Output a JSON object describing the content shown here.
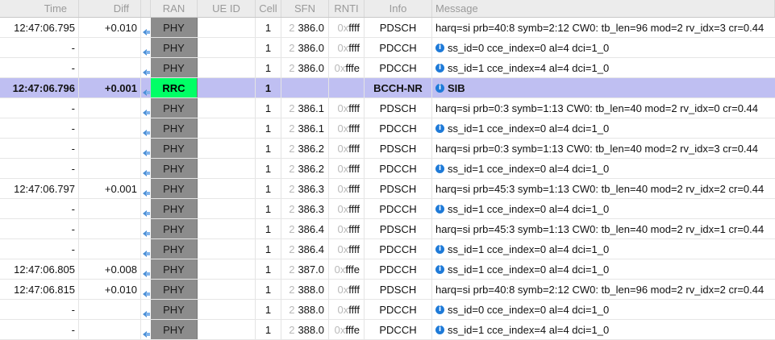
{
  "columns": {
    "time": "Time",
    "diff": "Diff",
    "ran": "RAN",
    "ue_id": "UE ID",
    "cell": "Cell",
    "sfn": "SFN",
    "rnti": "RNTI",
    "info": "Info",
    "message": "Message"
  },
  "colors": {
    "phy": "#8c8c8c",
    "rrc": "#00ff66",
    "selected_row": "#bfbff2"
  },
  "rows": [
    {
      "time": "12:47:06.795",
      "diff": "+0.010",
      "ran": "PHY",
      "ue_id": "",
      "cell": "1",
      "sfn_prefix": "2",
      "sfn": "386.0",
      "rnti_prefix": "0x",
      "rnti": "ffff",
      "info": "PDSCH",
      "info_icon": false,
      "message": "harq=si prb=40:8 symb=2:12 CW0: tb_len=96 mod=2 rv_idx=3 cr=0.44"
    },
    {
      "time": "-",
      "diff": "",
      "ran": "PHY",
      "ue_id": "",
      "cell": "1",
      "sfn_prefix": "2",
      "sfn": "386.0",
      "rnti_prefix": "0x",
      "rnti": "ffff",
      "info": "PDCCH",
      "info_icon": true,
      "message": "ss_id=0 cce_index=0 al=4 dci=1_0"
    },
    {
      "time": "-",
      "diff": "",
      "ran": "PHY",
      "ue_id": "",
      "cell": "1",
      "sfn_prefix": "2",
      "sfn": "386.0",
      "rnti_prefix": "0x",
      "rnti": "fffe",
      "info": "PDCCH",
      "info_icon": true,
      "message": "ss_id=1 cce_index=4 al=4 dci=1_0"
    },
    {
      "time": "12:47:06.796",
      "diff": "+0.001",
      "ran": "RRC",
      "ue_id": "",
      "cell": "1",
      "sfn_prefix": "",
      "sfn": "",
      "rnti_prefix": "",
      "rnti": "",
      "info": "BCCH-NR",
      "info_icon": true,
      "message": "SIB",
      "selected": true
    },
    {
      "time": "-",
      "diff": "",
      "ran": "PHY",
      "ue_id": "",
      "cell": "1",
      "sfn_prefix": "2",
      "sfn": "386.1",
      "rnti_prefix": "0x",
      "rnti": "ffff",
      "info": "PDSCH",
      "info_icon": false,
      "message": "harq=si prb=0:3 symb=1:13 CW0: tb_len=40 mod=2 rv_idx=0 cr=0.44"
    },
    {
      "time": "-",
      "diff": "",
      "ran": "PHY",
      "ue_id": "",
      "cell": "1",
      "sfn_prefix": "2",
      "sfn": "386.1",
      "rnti_prefix": "0x",
      "rnti": "ffff",
      "info": "PDCCH",
      "info_icon": true,
      "message": "ss_id=1 cce_index=0 al=4 dci=1_0"
    },
    {
      "time": "-",
      "diff": "",
      "ran": "PHY",
      "ue_id": "",
      "cell": "1",
      "sfn_prefix": "2",
      "sfn": "386.2",
      "rnti_prefix": "0x",
      "rnti": "ffff",
      "info": "PDSCH",
      "info_icon": false,
      "message": "harq=si prb=0:3 symb=1:13 CW0: tb_len=40 mod=2 rv_idx=3 cr=0.44"
    },
    {
      "time": "-",
      "diff": "",
      "ran": "PHY",
      "ue_id": "",
      "cell": "1",
      "sfn_prefix": "2",
      "sfn": "386.2",
      "rnti_prefix": "0x",
      "rnti": "ffff",
      "info": "PDCCH",
      "info_icon": true,
      "message": "ss_id=1 cce_index=0 al=4 dci=1_0"
    },
    {
      "time": "12:47:06.797",
      "diff": "+0.001",
      "ran": "PHY",
      "ue_id": "",
      "cell": "1",
      "sfn_prefix": "2",
      "sfn": "386.3",
      "rnti_prefix": "0x",
      "rnti": "ffff",
      "info": "PDSCH",
      "info_icon": false,
      "message": "harq=si prb=45:3 symb=1:13 CW0: tb_len=40 mod=2 rv_idx=2 cr=0.44"
    },
    {
      "time": "-",
      "diff": "",
      "ran": "PHY",
      "ue_id": "",
      "cell": "1",
      "sfn_prefix": "2",
      "sfn": "386.3",
      "rnti_prefix": "0x",
      "rnti": "ffff",
      "info": "PDCCH",
      "info_icon": true,
      "message": "ss_id=1 cce_index=0 al=4 dci=1_0"
    },
    {
      "time": "-",
      "diff": "",
      "ran": "PHY",
      "ue_id": "",
      "cell": "1",
      "sfn_prefix": "2",
      "sfn": "386.4",
      "rnti_prefix": "0x",
      "rnti": "ffff",
      "info": "PDSCH",
      "info_icon": false,
      "message": "harq=si prb=45:3 symb=1:13 CW0: tb_len=40 mod=2 rv_idx=1 cr=0.44"
    },
    {
      "time": "-",
      "diff": "",
      "ran": "PHY",
      "ue_id": "",
      "cell": "1",
      "sfn_prefix": "2",
      "sfn": "386.4",
      "rnti_prefix": "0x",
      "rnti": "ffff",
      "info": "PDCCH",
      "info_icon": true,
      "message": "ss_id=1 cce_index=0 al=4 dci=1_0"
    },
    {
      "time": "12:47:06.805",
      "diff": "+0.008",
      "ran": "PHY",
      "ue_id": "",
      "cell": "1",
      "sfn_prefix": "2",
      "sfn": "387.0",
      "rnti_prefix": "0x",
      "rnti": "fffe",
      "info": "PDCCH",
      "info_icon": true,
      "message": "ss_id=1 cce_index=0 al=4 dci=1_0"
    },
    {
      "time": "12:47:06.815",
      "diff": "+0.010",
      "ran": "PHY",
      "ue_id": "",
      "cell": "1",
      "sfn_prefix": "2",
      "sfn": "388.0",
      "rnti_prefix": "0x",
      "rnti": "ffff",
      "info": "PDSCH",
      "info_icon": false,
      "message": "harq=si prb=40:8 symb=2:12 CW0: tb_len=96 mod=2 rv_idx=2 cr=0.44"
    },
    {
      "time": "-",
      "diff": "",
      "ran": "PHY",
      "ue_id": "",
      "cell": "1",
      "sfn_prefix": "2",
      "sfn": "388.0",
      "rnti_prefix": "0x",
      "rnti": "ffff",
      "info": "PDCCH",
      "info_icon": true,
      "message": "ss_id=0 cce_index=0 al=4 dci=1_0"
    },
    {
      "time": "-",
      "diff": "",
      "ran": "PHY",
      "ue_id": "",
      "cell": "1",
      "sfn_prefix": "2",
      "sfn": "388.0",
      "rnti_prefix": "0x",
      "rnti": "fffe",
      "info": "PDCCH",
      "info_icon": true,
      "message": "ss_id=1 cce_index=4 al=4 dci=1_0"
    }
  ]
}
